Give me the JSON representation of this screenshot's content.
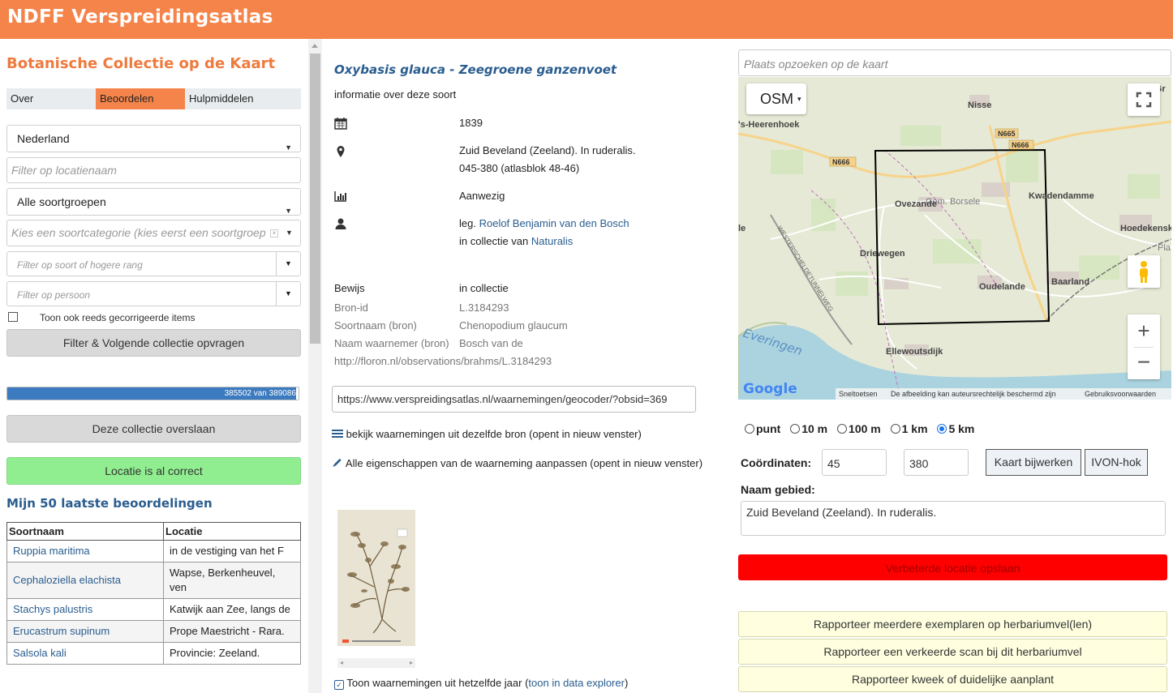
{
  "header": {
    "title": "NDFF Verspreidingsatlas"
  },
  "left": {
    "heading": "Botanische Collectie op de Kaart",
    "tabs": [
      {
        "label": "Over"
      },
      {
        "label": "Beoordelen"
      },
      {
        "label": "Hulpmiddelen"
      }
    ],
    "country_select": "Nederland",
    "location_filter_placeholder": "Filter op locatienaam",
    "species_group_select": "Alle soortgroepen",
    "species_category_placeholder": "Kies een soortcategorie (kies eerst een soortgroep",
    "higher_rank_placeholder": "Filter op soort of hogere rang",
    "person_placeholder": "Filter op persoon",
    "show_corrected_label": "Toon ook reeds gecorrigeerde items",
    "filter_button": "Filter & Volgende collectie opvragen",
    "progress": {
      "text": "385502 van 389086",
      "value": 385502,
      "max": 389086
    },
    "skip_button": "Deze collectie overslaan",
    "correct_button": "Locatie is al correct",
    "recent_heading": "Mijn 50 laatste beoordelingen",
    "recent_table": {
      "headers": [
        "Soortnaam",
        "Locatie"
      ],
      "rows": [
        {
          "name": "Ruppia maritima",
          "location": "in de vestiging van het F"
        },
        {
          "name": "Cephaloziella elachista",
          "location": "Wapse, Berkenheuvel, ven"
        },
        {
          "name": "Stachys palustris",
          "location": "Katwijk aan Zee, langs de"
        },
        {
          "name": "Erucastrum supinum",
          "location": "Prope Maestricht - Rara."
        },
        {
          "name": "Salsola kali",
          "location": "Provincie: Zeeland."
        }
      ]
    }
  },
  "middle": {
    "species_title": "Oxybasis glauca - Zeegroene ganzenvoet",
    "species_info_link": "informatie over deze soort",
    "date": "1839",
    "location_line1": "Zuid Beveland (Zeeland). In ruderalis.",
    "location_line2": "045-380 (atlasblok 48-46)",
    "status": "Aanwezig",
    "leg_prefix": "leg.",
    "leg_name": "Roelof Benjamin van den Bosch",
    "collection_prefix": "in collectie van",
    "collection_name": "Naturalis",
    "evidence": [
      {
        "label": "Bewijs",
        "value": "in collectie"
      },
      {
        "label": "Bron-id",
        "value": "L.3184293"
      },
      {
        "label": "Soortnaam (bron)",
        "value": "Chenopodium glaucum"
      },
      {
        "label": "Naam waarnemer (bron)",
        "value": "Bosch van de"
      }
    ],
    "source_url": "http://floron.nl/observations/brahms/L.3184293",
    "geocoder_url": "https://www.verspreidingsatlas.nl/waarnemingen/geocoder/?obsid=369",
    "same_source_link": "bekijk waarnemingen uit dezelfde bron (opent in nieuw venster)",
    "edit_link": "Alle eigenschappen van de waarneming aanpassen (opent in nieuw venster)",
    "same_year_label": "Toon waarnemingen uit hetzelfde jaar (",
    "same_year_link": "toon in data explorer",
    "same_year_suffix": ")"
  },
  "right": {
    "map_search_placeholder": "Plaats opzoeken op de kaart",
    "basemap": "OSM",
    "map_labels": [
      "Nisse",
      "'s-Heerenhoek",
      "N665",
      "N666",
      "N666",
      "Gem. Borsele",
      "Ovezande",
      "Kwadendamme",
      "Hoedekensk",
      "Driewegen",
      "Oudelande",
      "Baarland",
      "Ellewoutsdijk",
      "Everingen",
      "WESTERSCHELDETUNNELWEG",
      "s-Gr",
      "Pla",
      "le"
    ],
    "map_footer": {
      "google": "Google",
      "shortcuts": "Sneltoetsen",
      "copyright": "De afbeelding kan auteursrechtelijk beschermd zijn",
      "terms": "Gebruiksvoorwaarden"
    },
    "precision_options": [
      {
        "label": "punt",
        "selected": false
      },
      {
        "label": "10 m",
        "selected": false
      },
      {
        "label": "100 m",
        "selected": false
      },
      {
        "label": "1 km",
        "selected": false
      },
      {
        "label": "5 km",
        "selected": true
      }
    ],
    "coords_label": "Coördinaten:",
    "coord_x": "45",
    "coord_y": "380",
    "update_map_button": "Kaart bijwerken",
    "ivon_button": "IVON-hok",
    "area_name_label": "Naam gebied:",
    "area_name_value": "Zuid Beveland (Zeeland). In ruderalis.",
    "save_button": "Verbeterde locatie opslaan",
    "report_buttons": [
      "Rapporteer meerdere exemplaren op herbariumvel(len)",
      "Rapporteer een verkeerde scan bij dit herbariumvel",
      "Rapporteer kweek of duidelijke aanplant"
    ]
  },
  "colors": {
    "header": "#f5844a",
    "heading_orange": "#ef7a3d",
    "link_blue": "#2a5d8f",
    "progress": "#3c7bbf",
    "green": "#90ee90",
    "red": "#ff0000",
    "yellow": "#ffffe0"
  }
}
